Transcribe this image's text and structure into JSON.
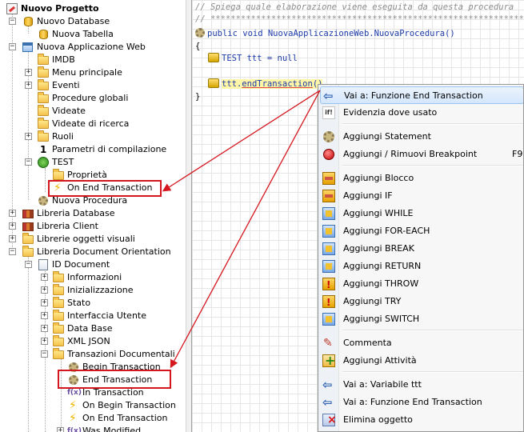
{
  "tree": {
    "root": "Nuovo Progetto",
    "nuovo_database": "Nuovo Database",
    "nuova_tabella": "Nuova Tabella",
    "nuova_app_web": "Nuova Applicazione Web",
    "imdb": "IMDB",
    "menu_principale": "Menu principale",
    "eventi": "Eventi",
    "procedure_globali": "Procedure globali",
    "videate": "Videate",
    "videate_ricerca": "Videate di ricerca",
    "ruoli": "Ruoli",
    "parametri": "Parametri di compilazione",
    "test": "TEST",
    "proprieta": "Proprietà",
    "on_end_transaction": "On End Transaction",
    "nuova_procedura": "Nuova Procedura",
    "libreria_database": "Libreria Database",
    "libreria_client": "Libreria Client",
    "librerie_oggetti": "Librerie oggetti visuali",
    "libreria_doc": "Libreria Document Orientation",
    "id_document": "ID Document",
    "informazioni": "Informazioni",
    "inizializzazione": "Inizializzazione",
    "stato": "Stato",
    "interfaccia_utente": "Interfaccia Utente",
    "data_base": "Data Base",
    "xml_json": "XML JSON",
    "transazioni": "Transazioni Documentali",
    "begin_transaction": "Begin Transaction",
    "end_transaction": "End Transaction",
    "in_transaction": "In Transaction",
    "on_begin_transaction": "On Begin Transaction",
    "on_end_transaction2": "On End Transaction",
    "was_modified": "Was Modified"
  },
  "editor": {
    "comment1": "// Spiega quale elaborazione viene eseguita da questa procedura",
    "comment2": "// ******************************************************************",
    "signature": "public void NuovaApplicazioneWeb.NuovaProcedura()",
    "open_brace": "{",
    "line_test": "TEST ttt = null",
    "line_call_obj": "ttt.",
    "line_call_method": "endTransaction",
    "line_call_tail": "()",
    "close_brace": "}"
  },
  "context_menu": {
    "items": [
      {
        "label": "Vai a: Funzione End Transaction",
        "icon": "back-arrow-icon"
      },
      {
        "label": "Evidenzia dove usato",
        "icon": "if-used-icon"
      },
      {
        "label": "Aggiungi Statement",
        "icon": "gear-icon"
      },
      {
        "label": "Aggiungi / Rimuovi Breakpoint",
        "icon": "breakpoint-icon",
        "shortcut": "F9"
      },
      {
        "label": "Aggiungi Blocco",
        "icon": "block-icon"
      },
      {
        "label": "Aggiungi IF",
        "icon": "if-block-icon"
      },
      {
        "label": "Aggiungi WHILE",
        "icon": "while-icon"
      },
      {
        "label": "Aggiungi FOR-EACH",
        "icon": "for-each-icon"
      },
      {
        "label": "Aggiungi BREAK",
        "icon": "break-icon"
      },
      {
        "label": "Aggiungi RETURN",
        "icon": "return-icon"
      },
      {
        "label": "Aggiungi THROW",
        "icon": "throw-icon"
      },
      {
        "label": "Aggiungi TRY",
        "icon": "try-icon"
      },
      {
        "label": "Aggiungi SWITCH",
        "icon": "switch-icon"
      },
      {
        "label": "Commenta",
        "icon": "comment-icon"
      },
      {
        "label": "Aggiungi Attività",
        "icon": "add-activity-icon"
      },
      {
        "label": "Vai a: Variabile ttt",
        "icon": "back-arrow-icon"
      },
      {
        "label": "Vai a: Funzione End Transaction",
        "icon": "back-arrow-icon"
      },
      {
        "label": "Elimina oggetto",
        "icon": "delete-icon"
      }
    ]
  },
  "colors": {
    "highlight_box": "#d4161e",
    "arrow": "#d4161e",
    "code_keyword": "#1c3ba8",
    "comment": "#8c8c8c"
  }
}
